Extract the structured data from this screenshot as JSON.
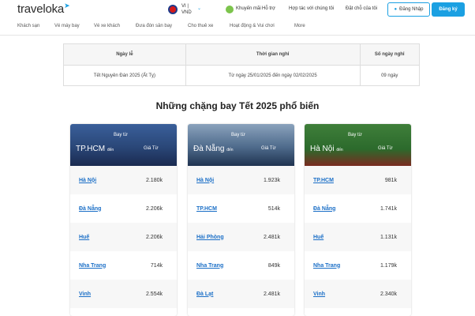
{
  "header": {
    "logo": "traveloka",
    "lang": "VI |",
    "currency": "VND",
    "promo": "Khuyến mãi",
    "support": "Hỗ trợ",
    "partner": "Hợp tác với chúng tôi",
    "bookings": "Đặt chỗ của tôi",
    "login": "Đăng Nhập",
    "register": "Đăng ký"
  },
  "nav": [
    "Khách sạn",
    "Vé máy bay",
    "Vé xe khách",
    "Đưa đón sân bay",
    "Cho thuê xe",
    "Hoạt động & Vui chơi",
    "More"
  ],
  "holiday_table": {
    "headers": [
      "Ngày lễ",
      "Thời gian nghỉ",
      "Số ngày nghỉ"
    ],
    "rows": [
      [
        "Tết Nguyên Đán 2025 (Ất Tỵ)",
        "Từ ngày 25/01/2025 đến ngày 02/02/2025",
        "09 ngày"
      ]
    ]
  },
  "section_title": "Những chặng bay Tết 2025 phổ biến",
  "cards": [
    {
      "from_label": "Bay từ",
      "city": "TP.HCM",
      "to_label": "đến",
      "price_label": "Giá Từ",
      "routes": [
        {
          "dest": "Hà Nội",
          "price": "2.180k"
        },
        {
          "dest": "Đà Nẵng",
          "price": "2.206k"
        },
        {
          "dest": "Huế",
          "price": "2.206k"
        },
        {
          "dest": "Nha Trang",
          "price": "714k"
        },
        {
          "dest": "Vinh",
          "price": "2.554k"
        }
      ]
    },
    {
      "from_label": "Bay từ",
      "city": "Đà Nẵng",
      "to_label": "đến",
      "price_label": "Giá Từ",
      "routes": [
        {
          "dest": "Hà Nội",
          "price": "1.923k"
        },
        {
          "dest": "TP.HCM",
          "price": "514k"
        },
        {
          "dest": "Hải Phòng",
          "price": "2.481k"
        },
        {
          "dest": "Nha Trang",
          "price": "849k"
        },
        {
          "dest": "Đà Lạt",
          "price": "2.481k"
        }
      ]
    },
    {
      "from_label": "Bay từ",
      "city": "Hà Nội",
      "to_label": "đến",
      "price_label": "Giá Từ",
      "routes": [
        {
          "dest": "TP.HCM",
          "price": "981k"
        },
        {
          "dest": "Đà Nẵng",
          "price": "1.741k"
        },
        {
          "dest": "Huế",
          "price": "1.131k"
        },
        {
          "dest": "Nha Trang",
          "price": "1.179k"
        },
        {
          "dest": "Vinh",
          "price": "2.340k"
        }
      ]
    }
  ]
}
